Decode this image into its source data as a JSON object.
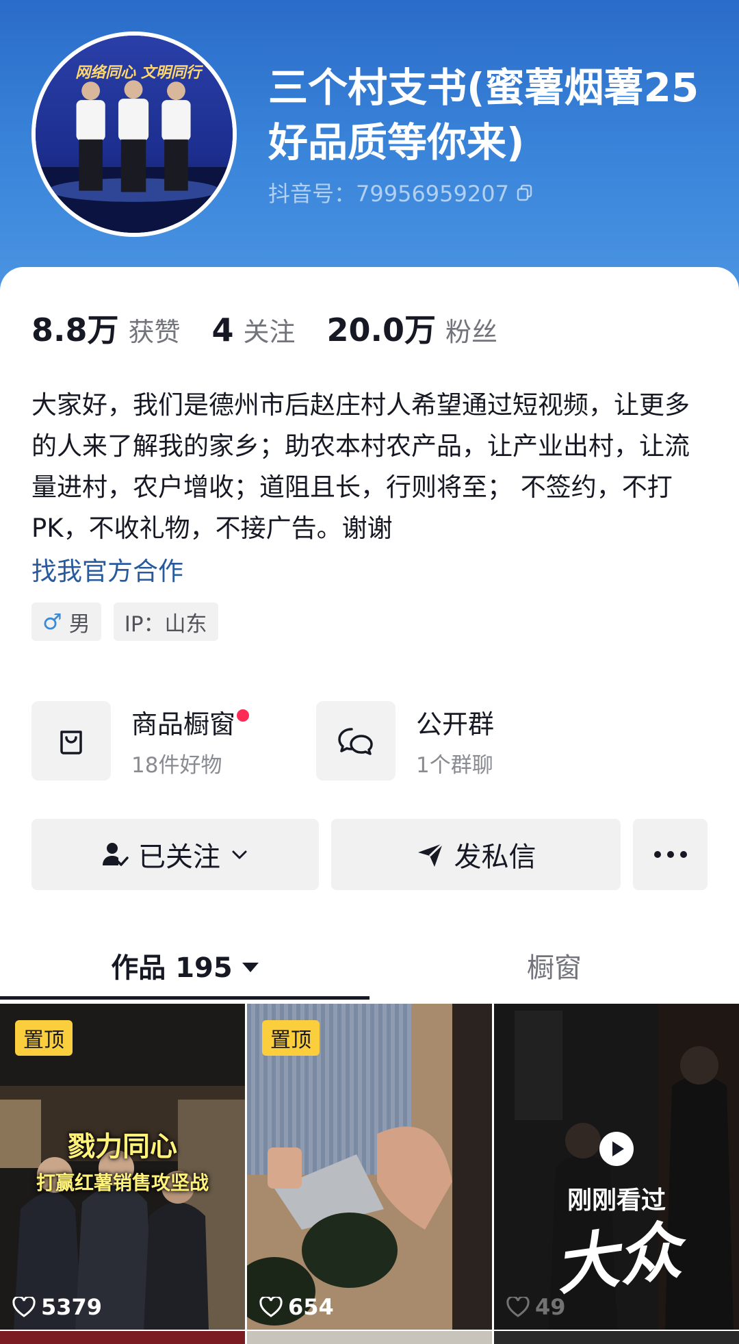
{
  "profile": {
    "nickname": "三个村支书(蜜薯烟薯25好品质等你来)",
    "douyin_id": "抖音号：79956959207",
    "avatar_banner": "网络同心 文明同行"
  },
  "stats": [
    {
      "value": "8.8万",
      "label": "获赞"
    },
    {
      "value": "4",
      "label": "关注"
    },
    {
      "value": "20.0万",
      "label": "粉丝"
    }
  ],
  "bio": "大家好，我们是德州市后赵庄村人希望通过短视频，让更多的人来了解我的家乡；助农本村农产品，让产业出村，让流量进村，农户增收；道阻且长，行则将至； 不签约，不打PK，不收礼物，不接广告。谢谢",
  "coop_link": "找我官方合作",
  "tags": {
    "gender": "男",
    "ip": "IP：山东"
  },
  "entries": {
    "shop": {
      "title": "商品橱窗",
      "subtitle": "18件好物",
      "icon": "shopping-bag-icon"
    },
    "group": {
      "title": "公开群",
      "subtitle": "1个群聊",
      "icon": "chat-bubbles-icon"
    }
  },
  "buttons": {
    "followed": "已关注",
    "message": "发私信"
  },
  "tabs": {
    "works": "作品 195",
    "showcase": "橱窗"
  },
  "videos": [
    {
      "pin": "置顶",
      "title_line1": "戮力同心",
      "title_line2": "打赢红薯销售攻坚战",
      "likes": "5379"
    },
    {
      "pin": "置顶",
      "likes": "654"
    },
    {
      "recent": "刚刚看过",
      "watermark": "大众",
      "likes": "49"
    }
  ],
  "colors": {
    "header_blue": "#3b86db",
    "accent_red": "#fe2c55",
    "link_blue": "#285a9e",
    "pin_yellow": "#fbce3e"
  }
}
